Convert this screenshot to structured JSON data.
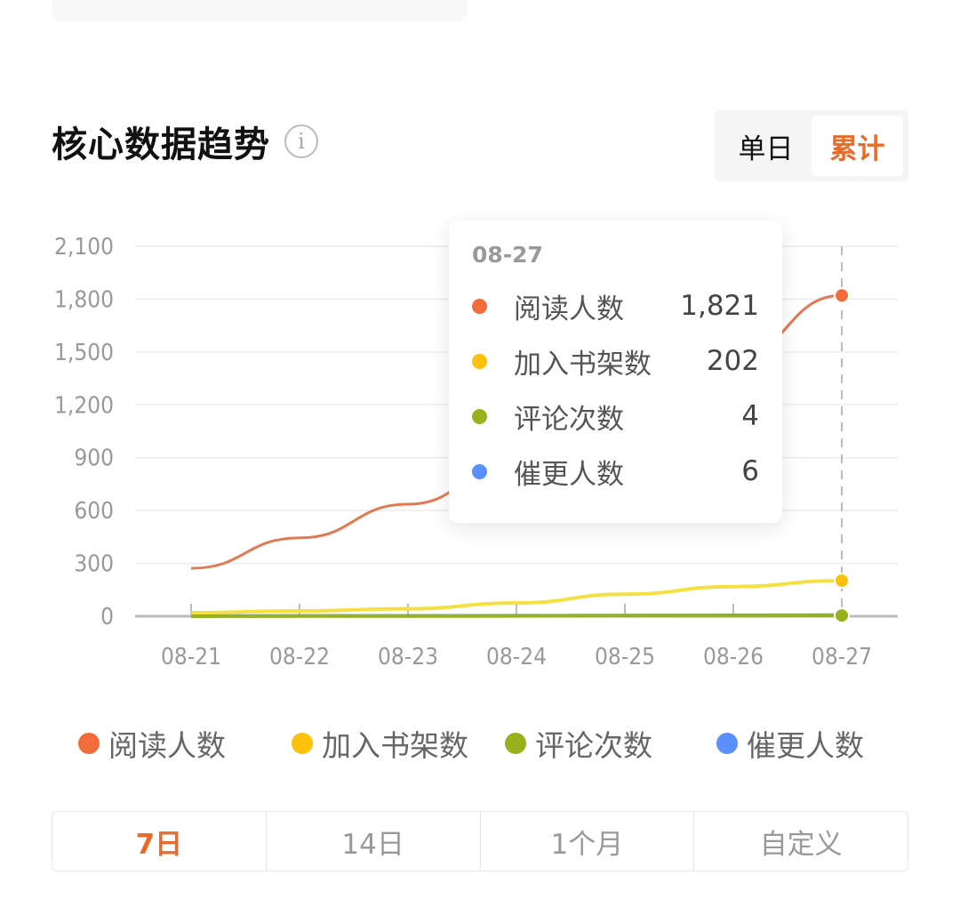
{
  "header": {
    "title": "核心数据趋势",
    "info_icon": "info-icon"
  },
  "mode_toggle": {
    "options": [
      "单日",
      "累计"
    ],
    "selected": "累计"
  },
  "tooltip": {
    "date": "08-27",
    "rows": [
      {
        "name": "阅读人数",
        "value": "1,821",
        "color": "#f26b3a"
      },
      {
        "name": "加入书架数",
        "value": "202",
        "color": "#fcc10a"
      },
      {
        "name": "评论次数",
        "value": "4",
        "color": "#97b21c"
      },
      {
        "name": "催更人数",
        "value": "6",
        "color": "#5b8ff9"
      }
    ]
  },
  "range_tabs": {
    "options": [
      "7日",
      "14日",
      "1个月",
      "自定义"
    ],
    "selected": "7日"
  },
  "chart_data": {
    "type": "line",
    "title": "核心数据趋势",
    "xlabel": "",
    "ylabel": "",
    "categories": [
      "08-21",
      "08-22",
      "08-23",
      "08-24",
      "08-25",
      "08-26",
      "08-27"
    ],
    "ylim": [
      0,
      2100
    ],
    "yticks": [
      0,
      300,
      600,
      900,
      1200,
      1500,
      1800,
      2100
    ],
    "ytick_labels": [
      "0",
      "300",
      "600",
      "900",
      "1,200",
      "1,500",
      "1,800",
      "2,100"
    ],
    "grid": true,
    "legend_position": "bottom",
    "series": [
      {
        "name": "阅读人数",
        "color": "#f26b3a",
        "line_color": "#e07a55",
        "values": [
          272,
          445,
          636,
          880,
          1150,
          1470,
          1821
        ]
      },
      {
        "name": "加入书架数",
        "color": "#fcc10a",
        "line_color": "#f5e042",
        "values": [
          20,
          30,
          42,
          75,
          125,
          168,
          202
        ]
      },
      {
        "name": "评论次数",
        "color": "#97b21c",
        "line_color": "#97b21c",
        "values": [
          0,
          1,
          1,
          2,
          3,
          3,
          4
        ]
      },
      {
        "name": "催更人数",
        "color": "#5b8ff9",
        "line_color": "#6a95c9",
        "values": [
          1,
          2,
          2,
          3,
          4,
          5,
          6
        ]
      }
    ],
    "highlight_category": "08-27"
  }
}
